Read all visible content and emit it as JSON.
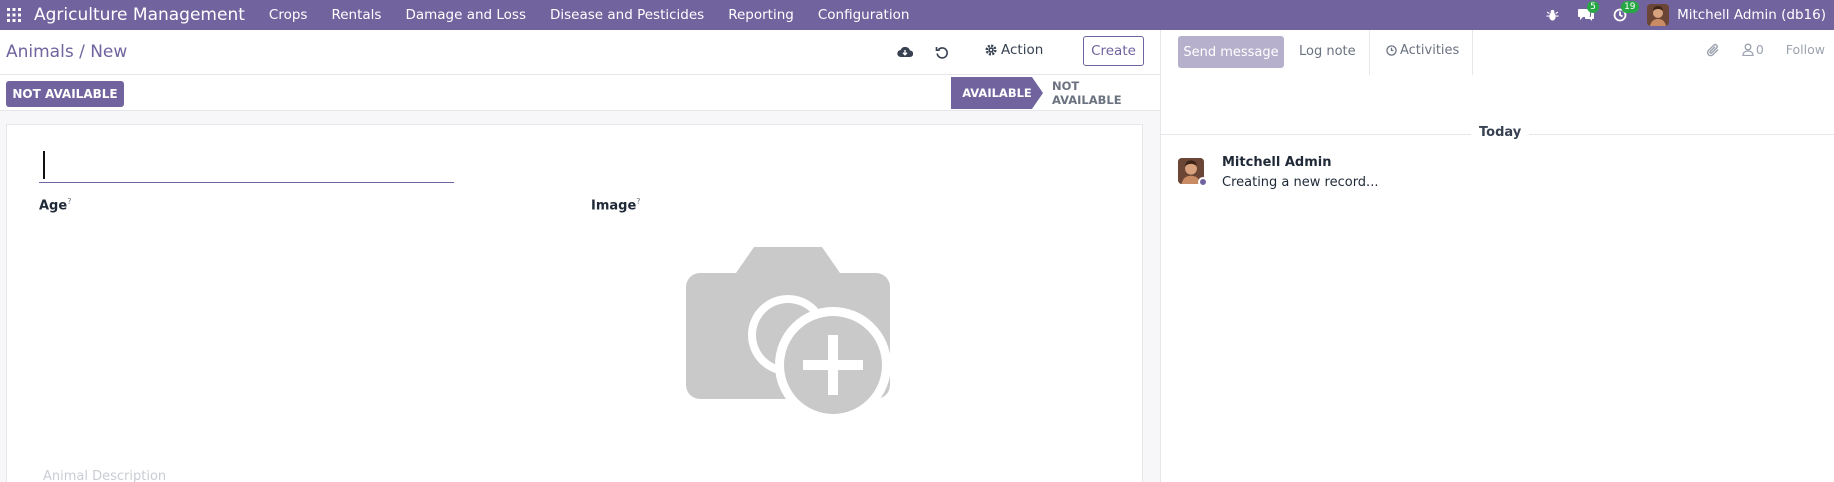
{
  "navbar": {
    "brand": "Agriculture Management",
    "menu": [
      "Crops",
      "Rentals",
      "Damage and Loss",
      "Disease and Pesticides",
      "Reporting",
      "Configuration"
    ],
    "messages_count": "5",
    "activities_count": "19",
    "user": "Mitchell Admin (db16)"
  },
  "control": {
    "breadcrumb": "Animals / New",
    "action_label": "Action",
    "create_label": "Create"
  },
  "status": {
    "button_label": "NOT AVAILABLE",
    "stages": [
      "AVAILABLE",
      "NOT AVAILABLE"
    ],
    "active_stage": "AVAILABLE"
  },
  "form": {
    "name_value": "",
    "age_label": "Age",
    "image_label": "Image",
    "tooltip_mark": "?",
    "description_placeholder": "Animal Description"
  },
  "chatter": {
    "send_message": "Send message",
    "log_note": "Log note",
    "activities": "Activities",
    "followers_count": "0",
    "follow": "Follow",
    "date_separator": "Today",
    "messages": [
      {
        "author": "Mitchell Admin",
        "body": "Creating a new record..."
      }
    ]
  },
  "colors": {
    "primary": "#71639e",
    "badge": "#28a745"
  }
}
